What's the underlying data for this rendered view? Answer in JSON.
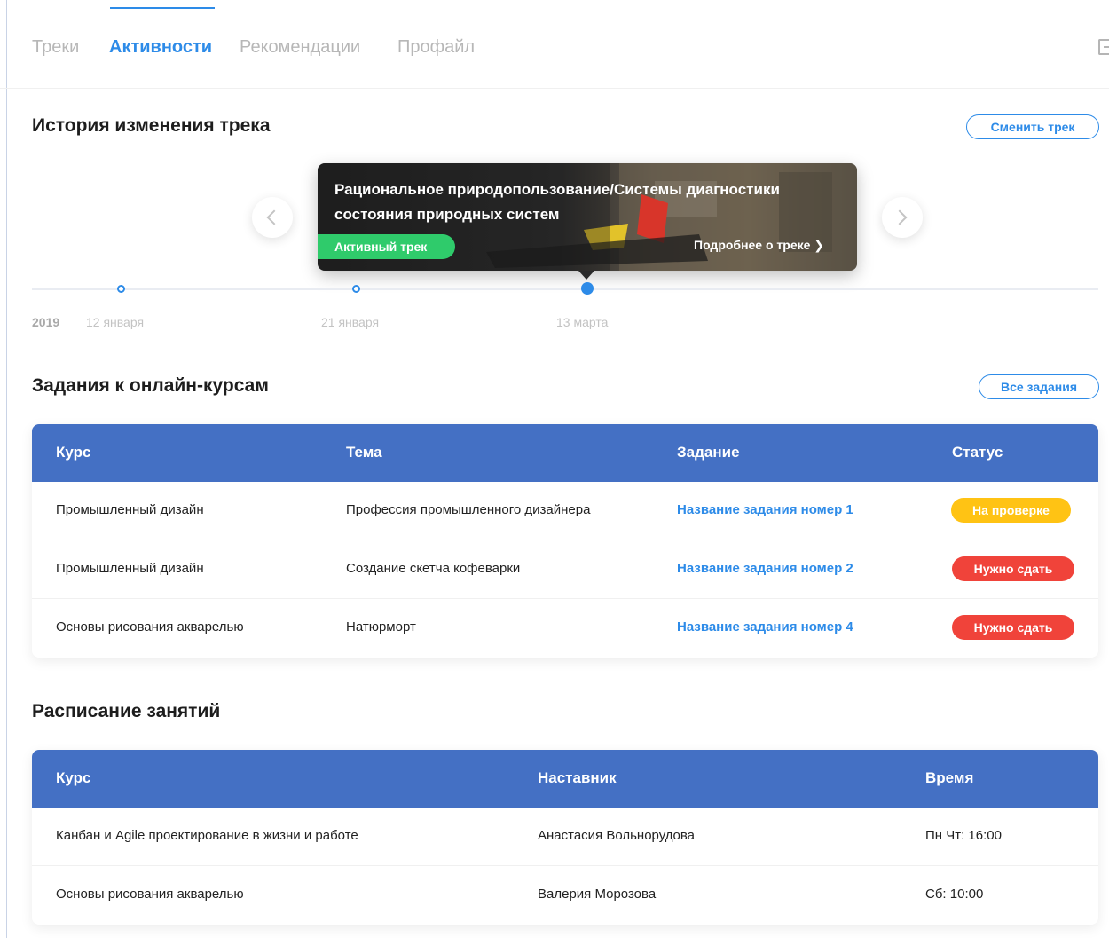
{
  "nav": {
    "tabs": [
      {
        "label": "Треки",
        "active": false
      },
      {
        "label": "Активности",
        "active": true
      },
      {
        "label": "Рекомендации",
        "active": false
      },
      {
        "label": "Профайл",
        "active": false
      }
    ],
    "exit_icon": "logout-icon"
  },
  "history": {
    "title": "История изменения трека",
    "change_button": "Сменить трек",
    "card": {
      "title": "Рациональное природопользование/Системы диагностики состояния природных систем",
      "badge": "Активный трек",
      "more": "Подробнее о треке ❯"
    },
    "timeline": {
      "year": "2019",
      "labels": [
        "12 января",
        "21 января",
        "13 марта"
      ]
    }
  },
  "tasks": {
    "title": "Задания к онлайн-курсам",
    "all_button": "Все задания",
    "columns": [
      "Курс",
      "Тема",
      "Задание",
      "Статус"
    ],
    "rows": [
      {
        "course": "Промышленный дизайн",
        "topic": "Профессия промышленного дизайнера",
        "task": "Название задания номер 1",
        "status": "На проверке",
        "status_type": "review"
      },
      {
        "course": "Промышленный дизайн",
        "topic": "Создание скетча кофеварки",
        "task": "Название задания номер 2",
        "status": "Нужно сдать",
        "status_type": "due"
      },
      {
        "course": "Основы рисования акварелью",
        "topic": "Натюрморт",
        "task": "Название задания номер 4",
        "status": "Нужно сдать",
        "status_type": "due"
      }
    ]
  },
  "schedule": {
    "title": "Расписание занятий",
    "columns": [
      "Курс",
      "Наставник",
      "Время"
    ],
    "rows": [
      {
        "course": "Канбан и Agile проектирование в жизни и работе",
        "mentor": "Анастасия Вольнорудова",
        "time": "Пн Чт: 16:00"
      },
      {
        "course": "Основы рисования акварелью",
        "mentor": "Валерия Морозова",
        "time": "Сб: 10:00"
      }
    ]
  },
  "colors": {
    "accent": "#2d8be8",
    "table_header": "#4470c4",
    "status_review": "#ffc314",
    "status_due": "#f0433a",
    "badge_active": "#2fcb6b"
  }
}
